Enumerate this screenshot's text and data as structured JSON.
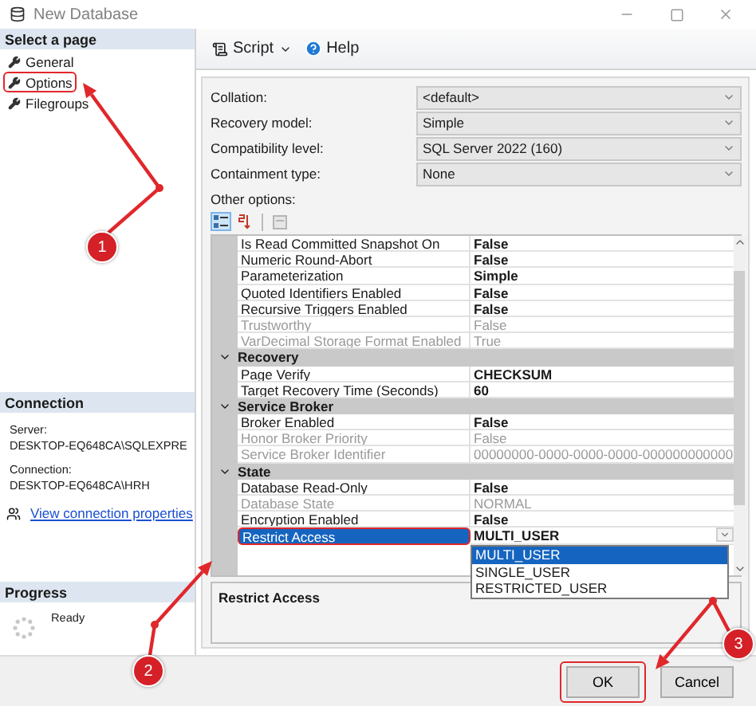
{
  "window": {
    "title": "New Database"
  },
  "sidebar": {
    "heading": "Select a page",
    "pages": [
      {
        "label": "General",
        "highlighted": false
      },
      {
        "label": "Options",
        "highlighted": true
      },
      {
        "label": "Filegroups",
        "highlighted": false
      }
    ]
  },
  "connection": {
    "heading": "Connection",
    "server_label": "Server:",
    "server": "DESKTOP-EQ648CA\\SQLEXPRE",
    "connection_label": "Connection:",
    "connection": "DESKTOP-EQ648CA\\HRH",
    "link": "View connection properties"
  },
  "progress": {
    "heading": "Progress",
    "status": "Ready"
  },
  "toolbar": {
    "script": "Script",
    "help": "Help"
  },
  "form": [
    {
      "label": "Collation:",
      "value": "<default>"
    },
    {
      "label": "Recovery model:",
      "value": "Simple"
    },
    {
      "label": "Compatibility level:",
      "value": "SQL Server 2022 (160)"
    },
    {
      "label": "Containment type:",
      "value": "None"
    }
  ],
  "other_options_label": "Other options:",
  "view_buttons": [
    {
      "kind": "categorized",
      "selected": true
    },
    {
      "kind": "alphabetical",
      "selected": false
    },
    {
      "kind": "pages",
      "selected": false
    }
  ],
  "property_grid": {
    "sections": [
      {
        "rows": [
          {
            "name": "Is Read Committed Snapshot On",
            "value": "False",
            "disabled": false,
            "selected": false,
            "highlighted": false
          },
          {
            "name": "Numeric Round-Abort",
            "value": "False",
            "disabled": false,
            "selected": false,
            "highlighted": false
          },
          {
            "name": "Parameterization",
            "value": "Simple",
            "disabled": false,
            "selected": false,
            "highlighted": false
          },
          {
            "name": "Quoted Identifiers Enabled",
            "value": "False",
            "disabled": false,
            "selected": false,
            "highlighted": false
          },
          {
            "name": "Recursive Triggers Enabled",
            "value": "False",
            "disabled": false,
            "selected": false,
            "highlighted": false
          },
          {
            "name": "Trustworthy",
            "value": "False",
            "disabled": true,
            "selected": false,
            "highlighted": false
          },
          {
            "name": "VarDecimal Storage Format Enabled",
            "value": "True",
            "disabled": true,
            "selected": false,
            "highlighted": false
          }
        ]
      },
      {
        "heading": "Recovery",
        "expanded": true,
        "rows": [
          {
            "name": "Page Verify",
            "value": "CHECKSUM",
            "disabled": false,
            "selected": false,
            "highlighted": false
          },
          {
            "name": "Target Recovery Time (Seconds)",
            "value": "60",
            "disabled": false,
            "selected": false,
            "highlighted": false
          }
        ]
      },
      {
        "heading": "Service Broker",
        "expanded": true,
        "rows": [
          {
            "name": "Broker Enabled",
            "value": "False",
            "disabled": false,
            "selected": false,
            "highlighted": false
          },
          {
            "name": "Honor Broker Priority",
            "value": "False",
            "disabled": true,
            "selected": false,
            "highlighted": false
          },
          {
            "name": "Service Broker Identifier",
            "value": "00000000-0000-0000-0000-000000000000",
            "disabled": true,
            "selected": false,
            "highlighted": false
          }
        ]
      },
      {
        "heading": "State",
        "expanded": true,
        "rows": [
          {
            "name": "Database Read-Only",
            "value": "False",
            "disabled": false,
            "selected": false,
            "highlighted": false
          },
          {
            "name": "Database State",
            "value": "NORMAL",
            "disabled": true,
            "selected": false,
            "highlighted": false
          },
          {
            "name": "Encryption Enabled",
            "value": "False",
            "disabled": false,
            "selected": false,
            "highlighted": false
          },
          {
            "name": "Restrict Access",
            "value": "MULTI_USER",
            "disabled": false,
            "selected": true,
            "highlighted": true
          }
        ]
      }
    ]
  },
  "dropdown": {
    "options": [
      {
        "label": "MULTI_USER",
        "selected": true
      },
      {
        "label": "SINGLE_USER",
        "selected": false
      },
      {
        "label": "RESTRICTED_USER",
        "selected": false
      }
    ]
  },
  "description": {
    "title": "Restrict Access"
  },
  "buttons": [
    {
      "label": "OK",
      "highlighted": true
    },
    {
      "label": "Cancel",
      "highlighted": false
    }
  ],
  "annotations": [
    {
      "label": "1"
    },
    {
      "label": "2"
    },
    {
      "label": "3"
    }
  ]
}
